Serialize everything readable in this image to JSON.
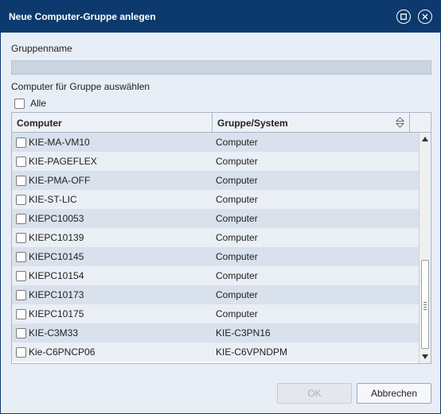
{
  "dialog": {
    "title": "Neue Computer-Gruppe anlegen",
    "group_name_label": "Gruppenname",
    "group_name_value": "",
    "select_label": "Computer für Gruppe auswählen",
    "select_all_label": "Alle"
  },
  "table": {
    "columns": [
      "Computer",
      "Gruppe/System"
    ],
    "rows": [
      {
        "computer": "KIE-MA-VM10",
        "group": "Computer"
      },
      {
        "computer": "KIE-PAGEFLEX",
        "group": "Computer"
      },
      {
        "computer": "KIE-PMA-OFF",
        "group": "Computer"
      },
      {
        "computer": "KIE-ST-LIC",
        "group": "Computer"
      },
      {
        "computer": "KIEPC10053",
        "group": "Computer"
      },
      {
        "computer": "KIEPC10139",
        "group": "Computer"
      },
      {
        "computer": "KIEPC10145",
        "group": "Computer"
      },
      {
        "computer": "KIEPC10154",
        "group": "Computer"
      },
      {
        "computer": "KIEPC10173",
        "group": "Computer"
      },
      {
        "computer": "KIEPC10175",
        "group": "Computer"
      },
      {
        "computer": "KIE-C3M33",
        "group": "KIE-C3PN16"
      },
      {
        "computer": "Kie-C6PNCP06",
        "group": "KIE-C6VPNDPM"
      }
    ]
  },
  "buttons": {
    "ok": "OK",
    "cancel": "Abbrechen"
  },
  "colors": {
    "titlebar": "#0c3a6e",
    "dialog_bg": "#e8eef6",
    "row_odd": "#d8e1ec",
    "row_even": "#eaeff5"
  },
  "icons": {
    "maximize": "maximize-icon",
    "close": "close-icon",
    "sort": "sort-icon"
  }
}
